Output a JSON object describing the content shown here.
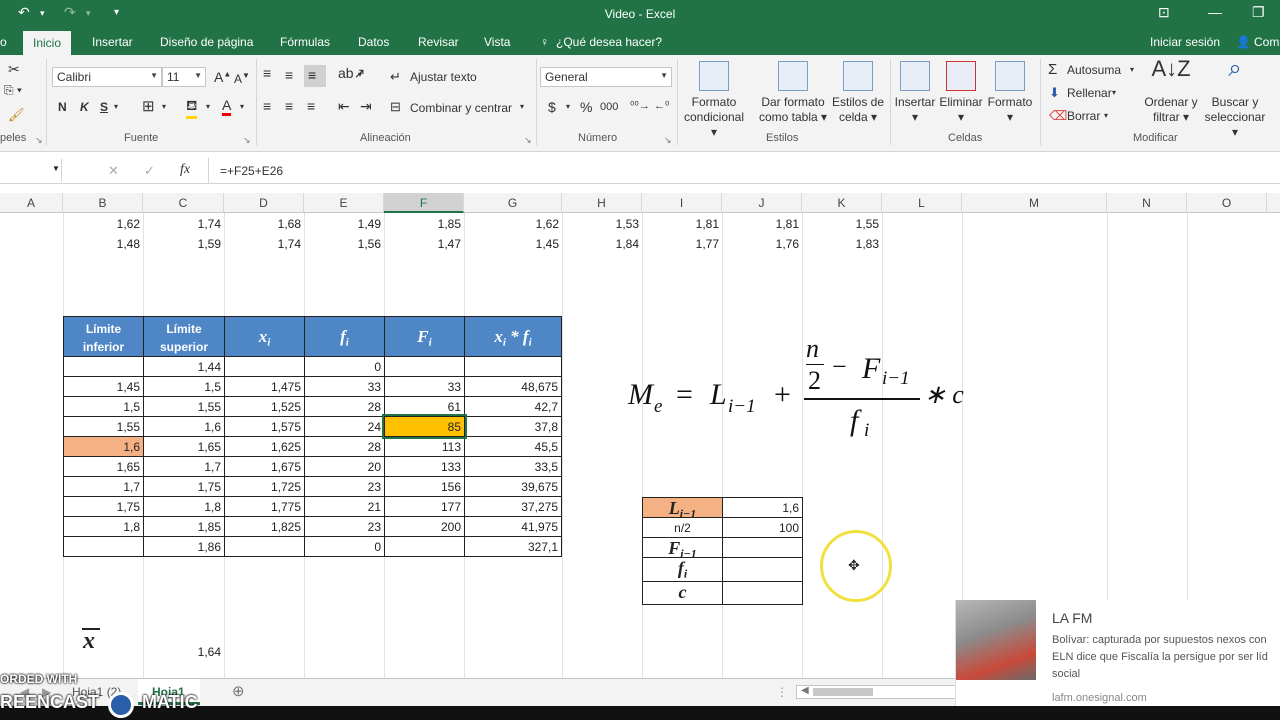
{
  "window": {
    "title": "Video - Excel"
  },
  "tabs": [
    {
      "label": "o"
    },
    {
      "label": "Inicio"
    },
    {
      "label": "Insertar"
    },
    {
      "label": "Diseño de página"
    },
    {
      "label": "Fórmulas"
    },
    {
      "label": "Datos"
    },
    {
      "label": "Revisar"
    },
    {
      "label": "Vista"
    },
    {
      "label": "¿Qué desea hacer?"
    }
  ],
  "account": {
    "signin": "Iniciar sesión",
    "share": "Com"
  },
  "ribbon": {
    "clipboard_label": "peles",
    "font": {
      "name": "Calibri",
      "size": "11",
      "label": "Fuente",
      "bold": "N",
      "italic": "K",
      "underline": "S"
    },
    "alignment": {
      "wrap": "Ajustar texto",
      "merge": "Combinar y centrar",
      "label": "Alineación"
    },
    "number": {
      "format": "General",
      "label": "Número",
      "currency": "$",
      "percent": "%",
      "thousands": "000"
    },
    "styles": {
      "conditional": "Formato condicional",
      "table": "Dar formato como tabla",
      "cell": "Estilos de celda",
      "label": "Estilos"
    },
    "cells": {
      "insert": "Insertar",
      "delete": "Eliminar",
      "format": "Formato",
      "label": "Celdas"
    },
    "editing": {
      "autosum": "Autosuma",
      "fill": "Rellenar",
      "clear": "Borrar",
      "sort": "Ordenar y filtrar",
      "find": "Buscar y seleccionar",
      "label": "Modificar"
    }
  },
  "formula_bar": {
    "fx": "fx",
    "formula": "=+F25+E26"
  },
  "columns": [
    "A",
    "B",
    "C",
    "D",
    "E",
    "F",
    "G",
    "H",
    "I",
    "J",
    "K",
    "L",
    "M",
    "N",
    "O"
  ],
  "top_rows": [
    [
      "1,62",
      "1,74",
      "1,68",
      "1,49",
      "1,85",
      "1,62",
      "1,53",
      "1,81",
      "1,81",
      "1,55"
    ],
    [
      "1,48",
      "1,59",
      "1,74",
      "1,56",
      "1,47",
      "1,45",
      "1,84",
      "1,77",
      "1,76",
      "1,83"
    ]
  ],
  "table": {
    "headers": {
      "li": "Límite inferior",
      "ls": "Límite superior",
      "xi": "x",
      "xi_sub": "i",
      "fi": "f",
      "fi_sub": "i",
      "Fi": "F",
      "Fi_sub": "i",
      "xf": "x",
      "xf_sub": "i",
      "xf_mid": " * f",
      "xf_sub2": "i"
    },
    "rows": [
      [
        "",
        "1,44",
        "",
        "0",
        "",
        ""
      ],
      [
        "1,45",
        "1,5",
        "1,475",
        "33",
        "33",
        "48,675"
      ],
      [
        "1,5",
        "1,55",
        "1,525",
        "28",
        "61",
        "42,7"
      ],
      [
        "1,55",
        "1,6",
        "1,575",
        "24",
        "85",
        "37,8"
      ],
      [
        "1,6",
        "1,65",
        "1,625",
        "28",
        "113",
        "45,5"
      ],
      [
        "1,65",
        "1,7",
        "1,675",
        "20",
        "133",
        "33,5"
      ],
      [
        "1,7",
        "1,75",
        "1,725",
        "23",
        "156",
        "39,675"
      ],
      [
        "1,75",
        "1,8",
        "1,775",
        "21",
        "177",
        "37,275"
      ],
      [
        "1,8",
        "1,85",
        "1,825",
        "23",
        "200",
        "41,975"
      ],
      [
        "",
        "1,86",
        "",
        "0",
        "",
        "327,1"
      ]
    ]
  },
  "mean": {
    "symbol": "x",
    "value": "1,64"
  },
  "formula_image": {
    "Me": "M",
    "Me_sub": "e",
    "eq": "=",
    "L": "L",
    "L_sub": "i−1",
    "plus": "+",
    "n": "n",
    "two": "2",
    "minus": "−",
    "F": "F",
    "F_sub": "i−1",
    "f": "f",
    "f_sub": "i",
    "times": "∗ c"
  },
  "params": {
    "labels": [
      {
        "main": "L",
        "sub": "i−1"
      },
      {
        "main": "n/2",
        "sub": ""
      },
      {
        "main": "F",
        "sub": "i−1"
      },
      {
        "main": "f",
        "sub": "i"
      },
      {
        "main": "c",
        "sub": ""
      }
    ],
    "values": [
      "1,6",
      "100",
      "",
      "",
      ""
    ]
  },
  "sheets": [
    {
      "label": "Hoja1 (2)"
    },
    {
      "label": "Hoja1"
    }
  ],
  "watermark": {
    "line1": "ORDED WITH",
    "line2": "REENCAST",
    "line3": "MATIC"
  },
  "notification": {
    "source": "LA FM",
    "text": "Bolívar: capturada por supuestos nexos con ELN dice que Fiscalía la persigue por ser líd social",
    "url": "lafm.onesignal.com"
  },
  "colors": {
    "excel_green": "#217346",
    "header_blue": "#4f86c6",
    "highlight_orange": "#f4b183",
    "highlight_yellow": "#ffc000"
  }
}
